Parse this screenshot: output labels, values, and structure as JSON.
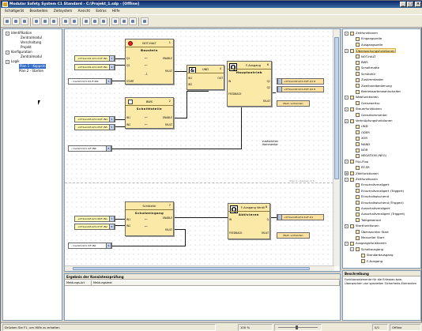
{
  "window": {
    "title": "Modular Safety System C1 Standard - C:\\Projekt_1.sdp - [Offline]"
  },
  "menu": [
    "Schaltgerät",
    "Bearbeiten",
    "Zeitsystem",
    "Ansicht",
    "Extras",
    "Hilfe"
  ],
  "left_tree": {
    "items": [
      {
        "label": "Identifikation",
        "level": 1,
        "expander": "-"
      },
      {
        "label": "Zentralmodul",
        "level": 2
      },
      {
        "label": "Verschaltung",
        "level": 2
      },
      {
        "label": "Projekt",
        "level": 2
      },
      {
        "label": "Konfiguration",
        "level": 1,
        "expander": "-"
      },
      {
        "label": "Zentralmodul",
        "level": 2
      },
      {
        "label": "Logik",
        "level": 1,
        "expander": "-"
      },
      {
        "label": "Plan 1 - Koppeln",
        "level": 2,
        "selected": true
      },
      {
        "label": "Plan 2 - Starten",
        "level": 2
      }
    ]
  },
  "diagram": {
    "blocks": {
      "nothalt": {
        "header": "NOT-HALT",
        "number": "1",
        "name": "Baustein",
        "pins": [
          "Q1",
          "Q2",
          "START",
          "FREIGABE",
          "ENABLE",
          "FAULT"
        ]
      },
      "bws": {
        "header": "BWS",
        "number": "2",
        "name": "Schnittstelle",
        "pins": [
          "IN1",
          "IN2",
          "ENABLE",
          "FAULT"
        ]
      },
      "und": {
        "header": "UND",
        "number": "4",
        "symbol": "&",
        "pins": [
          "IN1",
          "IN2",
          "OUT"
        ]
      },
      "ausgang1": {
        "header": "F-Ausgang",
        "number": "6",
        "name": "Hauptantrieb",
        "pins": [
          "IN",
          "FEEDBACK",
          "Q1",
          "Q2",
          "FAULT"
        ]
      },
      "schutz": {
        "header": "Schütztür",
        "number": "7",
        "name": "Schutzeingang",
        "pins": [
          "IN1",
          "IN2",
          "ENABLE",
          "FAULT"
        ]
      },
      "ausgang2": {
        "header": "F-Ausgang Ventil",
        "number": "8",
        "name": "Aktivieren",
        "pins": [
          "IN",
          "FEEDBACK",
          "Q",
          "FAULT"
        ]
      }
    },
    "inputs": [
      "+ST1/ein01.0/I1.01/F-IN1",
      "+ST1/ein01.0/I1.02/F-IN1",
      "- 1/ein01.0/I1.0/1/F-IN2",
      "+ST1/ein03.0/I1.04/F-IN4",
      "+ST1/ein03.0/I1.05/F-IN5",
      "- 1/ein01.0/I1.4/F-IN6",
      "+ST1/ein03.0/I1.06/F-IN1",
      "+ST1/ein03.0/I1.07/F-IN2",
      "- 1/ein01.0/I1.3/F-IN1"
    ],
    "input_indices": [
      "1",
      "2",
      "3",
      "4",
      "5",
      "6",
      "7",
      "8",
      "9"
    ],
    "outputs": [
      "+ST1/ein02.0/I1.03/F-Q1 R",
      "+ST1/ein02.0/I1.03/F-Q2 R",
      "+ST1/ein05.0/I1.01/F-Q1"
    ],
    "fault_labels": [
      "Meld. vorhanden",
      "Meld. vorhanden"
    ],
    "comment": "zusätzlicher\nKommentar",
    "page_labels": [
      "(Plan 1 - Koppeln 1/1)"
    ]
  },
  "results_panel": {
    "title": "Ergebnis der Konsistenzprüfung",
    "columns": [
      "Meldungs-Art",
      "Meldungstext"
    ]
  },
  "right_tree": {
    "items": [
      {
        "label": "Zeitfunktionen",
        "level": 0,
        "expander": "-"
      },
      {
        "label": "Eingangszelle",
        "level": 1
      },
      {
        "label": "Ausgangszelle",
        "level": 1
      },
      {
        "label": "Überwachungsfunktionen",
        "level": 0,
        "expander": "-",
        "highlight": true
      },
      {
        "label": "NOT-HALT",
        "level": 1
      },
      {
        "label": "BWS",
        "level": 1
      },
      {
        "label": "Schaltmatte",
        "level": 1
      },
      {
        "label": "Schütztür",
        "level": 1
      },
      {
        "label": "Zustimmtaster",
        "level": 1
      },
      {
        "label": "Zweihandbedienung",
        "level": 1
      },
      {
        "label": "Betriebsartenwahlschalter",
        "level": 1
      },
      {
        "label": "Webfunktionen",
        "level": 0,
        "expander": "-"
      },
      {
        "label": "Grenzwertsc",
        "level": 1
      },
      {
        "label": "Steuerfunktionen",
        "level": 0,
        "expander": "-"
      },
      {
        "label": "Grenzkommentar",
        "level": 1
      },
      {
        "label": "Verknüpfungsfunktionen",
        "level": 0,
        "expander": "-"
      },
      {
        "label": "UND",
        "level": 1
      },
      {
        "label": "ODER",
        "level": 1
      },
      {
        "label": "XOR",
        "level": 1
      },
      {
        "label": "NAND",
        "level": 1
      },
      {
        "label": "NOR",
        "level": 1
      },
      {
        "label": "NEGATION (NEG)",
        "level": 1
      },
      {
        "label": "Flip-Flop",
        "level": 0,
        "expander": "-"
      },
      {
        "label": "RT-SR",
        "level": 1
      },
      {
        "label": "Zählfunktionen",
        "level": 0,
        "expander": "+"
      },
      {
        "label": "Zeitfunktionen",
        "level": 0,
        "expander": "-"
      },
      {
        "label": "Einschaltverzögert",
        "level": 1
      },
      {
        "label": "Einschaltverzögert (Triggert)",
        "level": 1
      },
      {
        "label": "Einschaltwischend",
        "level": 1
      },
      {
        "label": "Einschaltwischend (Triggert)",
        "level": 1
      },
      {
        "label": "Ausschaltverzögert",
        "level": 1
      },
      {
        "label": "Ausschaltverzögert (Triggert)",
        "level": 1
      },
      {
        "label": "Taktgeberaut",
        "level": 1
      },
      {
        "label": "Startfunktionen",
        "level": 0,
        "expander": "-"
      },
      {
        "label": "Überwachter Start",
        "level": 1
      },
      {
        "label": "Manueller Start",
        "level": 1
      },
      {
        "label": "Ausgangsfunktionen",
        "level": 0,
        "expander": "-"
      },
      {
        "label": "Schaltausgang",
        "level": 1,
        "expander": "-"
      },
      {
        "label": "Standardausgang",
        "level": 2
      },
      {
        "label": "F-Ausgang",
        "level": 2
      }
    ]
  },
  "description_panel": {
    "title": "Beschreibung",
    "text": "Funktionselemente für die Erfassen bzw. Überwachen von speziellen Sicherheits-Elementen"
  },
  "statusbar": {
    "help": "Drücken Sie F1, um Hilfe zu erhalten",
    "zoom": "100 %",
    "mode": "Offline",
    "pos": "0/1"
  },
  "colors": {
    "block_fill": "#fbe9a7",
    "input_fill": "#fdf9b5",
    "selection": "#316ac5"
  }
}
